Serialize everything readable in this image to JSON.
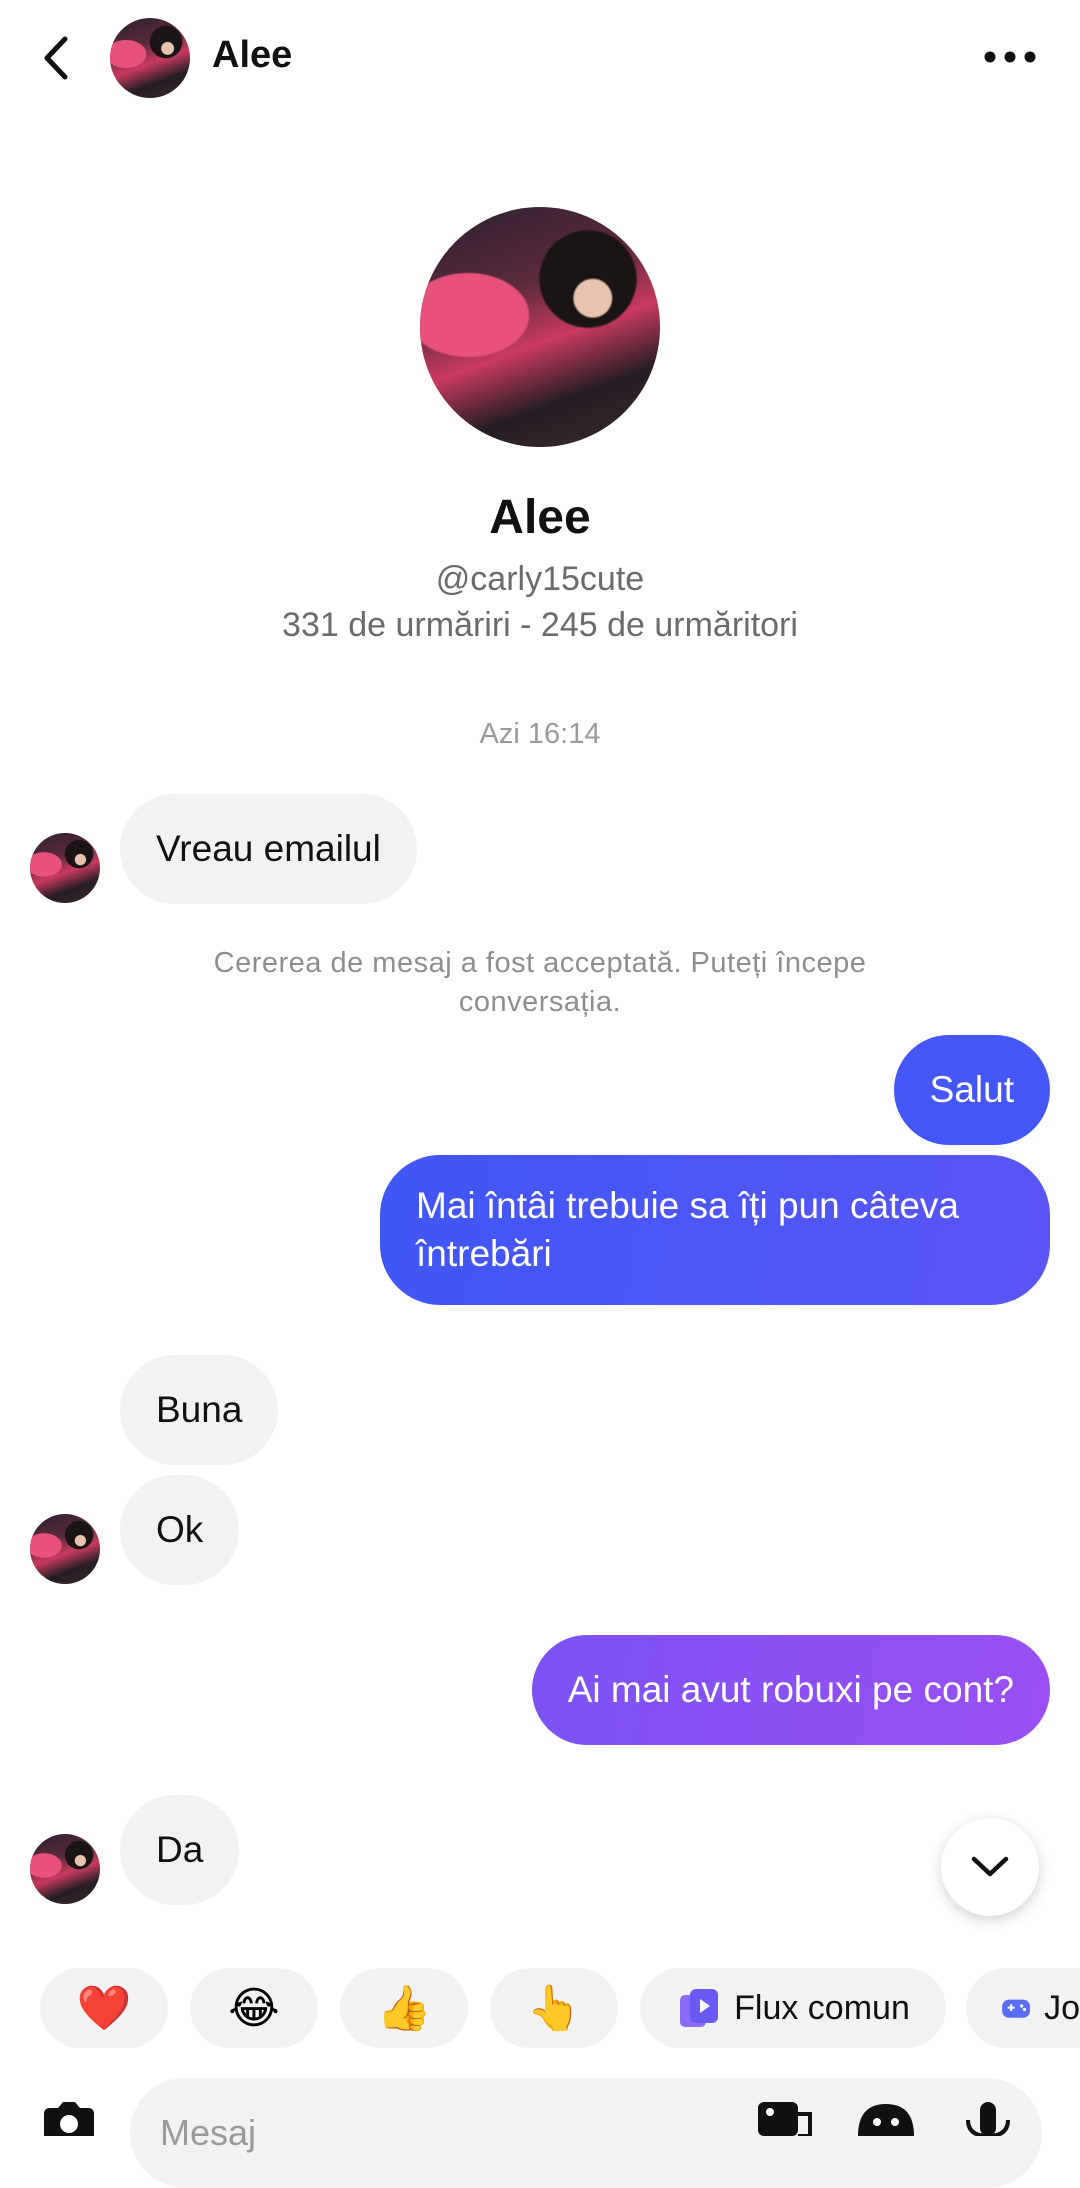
{
  "header": {
    "back_icon": "chevron-left-icon",
    "contact_name": "Alee",
    "more_icon": "more-horizontal-icon"
  },
  "profile": {
    "name": "Alee",
    "handle": "@carly15cute",
    "stats": "331 de urmăriri - 245 de urmăritori"
  },
  "chat": {
    "timestamp": "Azi 16:14",
    "notice": "Cererea de mesaj a fost acceptată. Puteți începe conversația.",
    "messages": [
      {
        "from": "them",
        "text": "Vreau emailul"
      },
      {
        "from": "me",
        "text": "Salut"
      },
      {
        "from": "me",
        "text": "Mai întâi trebuie sa îți pun câteva întrebări"
      },
      {
        "from": "them",
        "text": "Buna"
      },
      {
        "from": "them",
        "text": "Ok"
      },
      {
        "from": "me",
        "text": "Ai mai avut robuxi pe cont?"
      },
      {
        "from": "them",
        "text": "Da"
      }
    ]
  },
  "quick_actions": [
    {
      "emoji": "❤️",
      "name": "heart"
    },
    {
      "emoji": "😂",
      "name": "laughing"
    },
    {
      "emoji": "👍",
      "name": "thumbs-up"
    },
    {
      "emoji": "👆",
      "name": "pointing-up"
    },
    {
      "icon": "shared-feed-icon",
      "label": "Flux comun"
    },
    {
      "icon": "gamepad-icon",
      "label": "Jo"
    }
  ],
  "composer": {
    "placeholder": "Mesaj",
    "icons": [
      "camera-icon",
      "image-icon",
      "sticker-icon",
      "microphone-icon"
    ]
  },
  "colors": {
    "outgoing_gradient_start": "#3f56f5",
    "outgoing_gradient_end": "#8e4ff2",
    "incoming_bubble": "#f2f2f2"
  }
}
